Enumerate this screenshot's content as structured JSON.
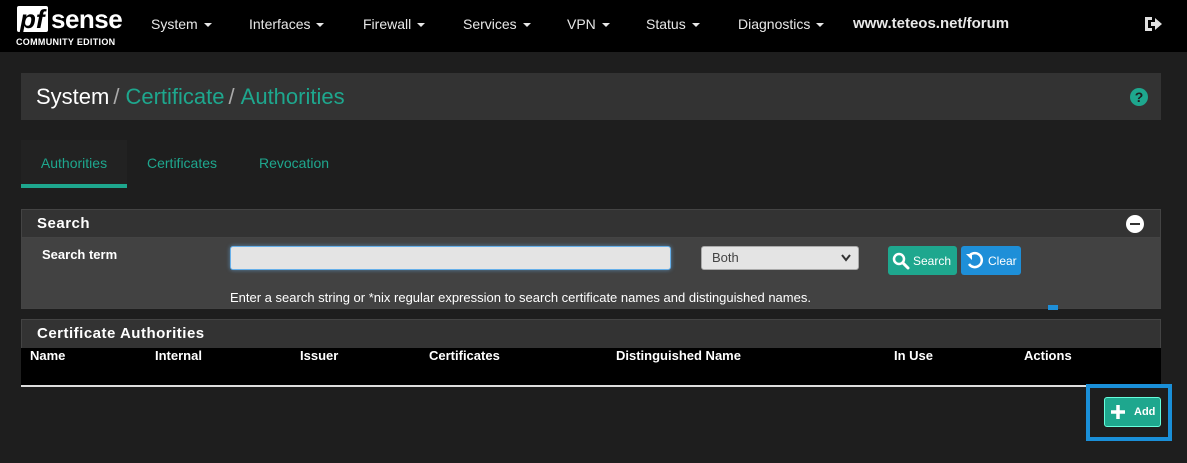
{
  "navbar": {
    "logo_pf": "pf",
    "logo_sense": "sense",
    "logo_edition": "COMMUNITY EDITION",
    "menu": [
      "System",
      "Interfaces",
      "Firewall",
      "Services",
      "VPN",
      "Status",
      "Diagnostics"
    ],
    "url": "www.teteos.net/forum",
    "logout_icon": "sign-out-icon"
  },
  "breadcrumb": {
    "root": "System",
    "sep1": "/",
    "level2": "Certificate",
    "sep2": "/",
    "level3": "Authorities",
    "help_icon": "?"
  },
  "tabs": [
    {
      "label": "Authorities",
      "active": true
    },
    {
      "label": "Certificates",
      "active": false
    },
    {
      "label": "Revocation",
      "active": false
    }
  ],
  "search_panel": {
    "title": "Search",
    "term_label": "Search term",
    "input_value": "",
    "select_value": "Both",
    "search_button": "Search",
    "clear_button": "Clear",
    "help_text": "Enter a search string or *nix regular expression to search certificate names and distinguished names."
  },
  "ca_panel": {
    "title": "Certificate Authorities",
    "columns": [
      "Name",
      "Internal",
      "Issuer",
      "Certificates",
      "Distinguished Name",
      "In Use",
      "Actions"
    ]
  },
  "add_button": "Add",
  "colors": {
    "accent": "#1ea78e",
    "info": "#1e8fd8",
    "background": "#1e1e1e",
    "highlight": "#1a8fd8"
  }
}
